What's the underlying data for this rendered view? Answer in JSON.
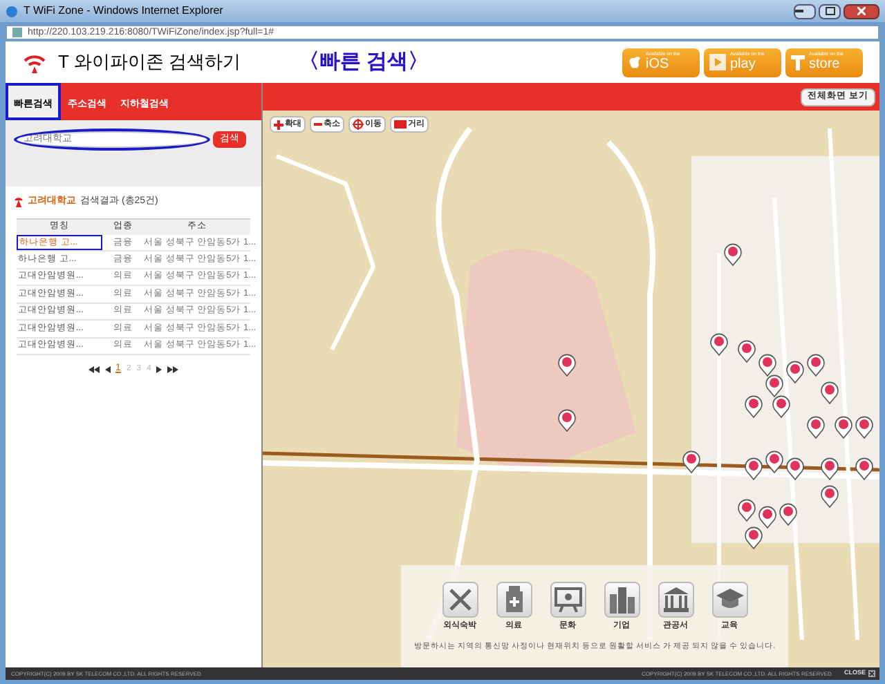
{
  "window": {
    "title": "T WiFi Zone - Windows Internet Explorer",
    "url": "http://220.103.219.216:8080/TWiFiZone/index.jsp?full=1#"
  },
  "header": {
    "title": "T 와이파이존 검색하기",
    "annotation": "〈빠른 검색〉",
    "stores": [
      {
        "kind": "ios",
        "small": "Available on the",
        "label": "iOS"
      },
      {
        "kind": "play",
        "small": "Available on the",
        "label": "play"
      },
      {
        "kind": "tstore",
        "small": "Available on the",
        "label": "store"
      }
    ]
  },
  "tabs": [
    {
      "label": "빠른검색",
      "selected": true
    },
    {
      "label": "주소검색",
      "selected": false
    },
    {
      "label": "지하철검색",
      "selected": false
    }
  ],
  "search": {
    "value": "고려대학교",
    "button": "검색"
  },
  "results": {
    "keyword": "고려대학교",
    "summary": "검색결과 (총25건)",
    "columns": [
      "명칭",
      "업종",
      "주소"
    ],
    "rows": [
      {
        "name": "하나은행 고...",
        "category": "금융",
        "address": "서울 성북구 안암동5가 1...",
        "selected": true
      },
      {
        "name": "하나은행 고...",
        "category": "금융",
        "address": "서울 성북구 안암동5가 1...",
        "selected": false
      },
      {
        "name": "고대안암병원...",
        "category": "의료",
        "address": "서울 성북구 안암동5가 1...",
        "selected": false
      },
      {
        "name": "고대안암병원...",
        "category": "의료",
        "address": "서울 성북구 안암동5가 1...",
        "selected": false
      },
      {
        "name": "고대안암병원...",
        "category": "의료",
        "address": "서울 성북구 안암동5가 1...",
        "selected": false
      },
      {
        "name": "고대안암병원...",
        "category": "의료",
        "address": "서울 성북구 안암동5가 1...",
        "selected": false
      },
      {
        "name": "고대안암병원...",
        "category": "의료",
        "address": "서울 성북구 안암동5가 1...",
        "selected": false
      }
    ],
    "pages": [
      {
        "label": "1",
        "selected": true
      },
      {
        "label": "2",
        "selected": false
      },
      {
        "label": "3",
        "selected": false
      },
      {
        "label": "4",
        "selected": false
      }
    ]
  },
  "map": {
    "fullscreen_button": "전체화면 보기",
    "tools": [
      {
        "kind": "zoom-in",
        "label": "확대"
      },
      {
        "kind": "zoom-out",
        "label": "축소"
      },
      {
        "kind": "move",
        "label": "이동"
      },
      {
        "kind": "distance",
        "label": "거리"
      }
    ],
    "categories": [
      {
        "kind": "food",
        "label": "외식숙박"
      },
      {
        "kind": "medical",
        "label": "의료"
      },
      {
        "kind": "culture",
        "label": "문화"
      },
      {
        "kind": "company",
        "label": "기업"
      },
      {
        "kind": "government",
        "label": "관공서"
      },
      {
        "kind": "education",
        "label": "교육"
      }
    ],
    "notice": "방문하시는 지역의 통신망 사정이나 현재위치 등으로 원활할 서비스 가 제공 되지 않을 수 있습니다."
  },
  "footer": {
    "left": "COPYRIGHT(C) 2009 BY SK TELECOM CO.,LTD. ALL RIGHTS RESERVED.",
    "right": "COPYRIGHT(C) 2009 BY SK TELECOM CO.,LTD. ALL RIGHTS RESERVED.",
    "close": "CLOSE"
  }
}
